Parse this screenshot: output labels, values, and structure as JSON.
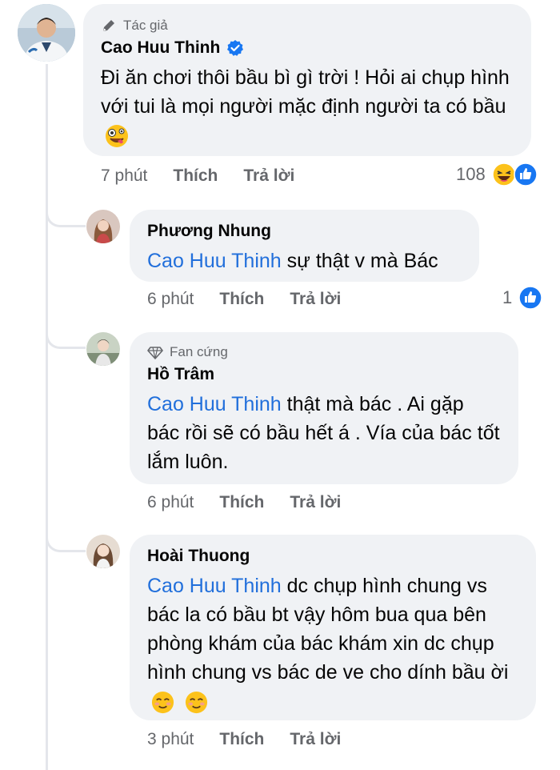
{
  "colors": {
    "mention": "#216fdb",
    "bubble": "#f0f2f5",
    "like_blue": "#1877f2",
    "verified": "#1877f2",
    "muted": "#65676b"
  },
  "main_comment": {
    "badge": "Tác giả",
    "author": "Cao Huu Thinh",
    "verified": true,
    "text": "Đi ăn chơi thôi bầu bì gì trời ! Hỏi ai chụp hình với tui là mọi người mặc định người ta có bầu",
    "emoji": "zany-face",
    "time": "7 phút",
    "like_label": "Thích",
    "reply_label": "Trả lời",
    "reaction_count": "108",
    "reaction_icons": [
      "laughing-emoji",
      "like-icon"
    ]
  },
  "replies": [
    {
      "author": "Phương Nhung",
      "mention": "Cao Huu Thinh",
      "text": " sự thật v mà Bác",
      "time": "6 phút",
      "like_label": "Thích",
      "reply_label": "Trả lời",
      "reaction_count": "1"
    },
    {
      "badge": "Fan cứng",
      "author": "Hồ Trâm",
      "mention": "Cao Huu Thinh",
      "text": " thật mà bác . Ai gặp bác rồi sẽ có bầu hết á . Vía của bác tốt lắm luôn.",
      "time": "6 phút",
      "like_label": "Thích",
      "reply_label": "Trả lời"
    },
    {
      "author": "Hoài Thuong",
      "mention": "Cao Huu Thinh",
      "text": " dc chụp hình chung vs bác la có bầu bt vậy hôm bua qua bên phòng khám của bác khám xin dc chụp hình chung vs bác de ve cho dính bầu ời",
      "emojis": [
        "smiling-face-emoji",
        "smiling-face-emoji"
      ],
      "time": "3 phút",
      "like_label": "Thích",
      "reply_label": "Trả lời"
    }
  ]
}
